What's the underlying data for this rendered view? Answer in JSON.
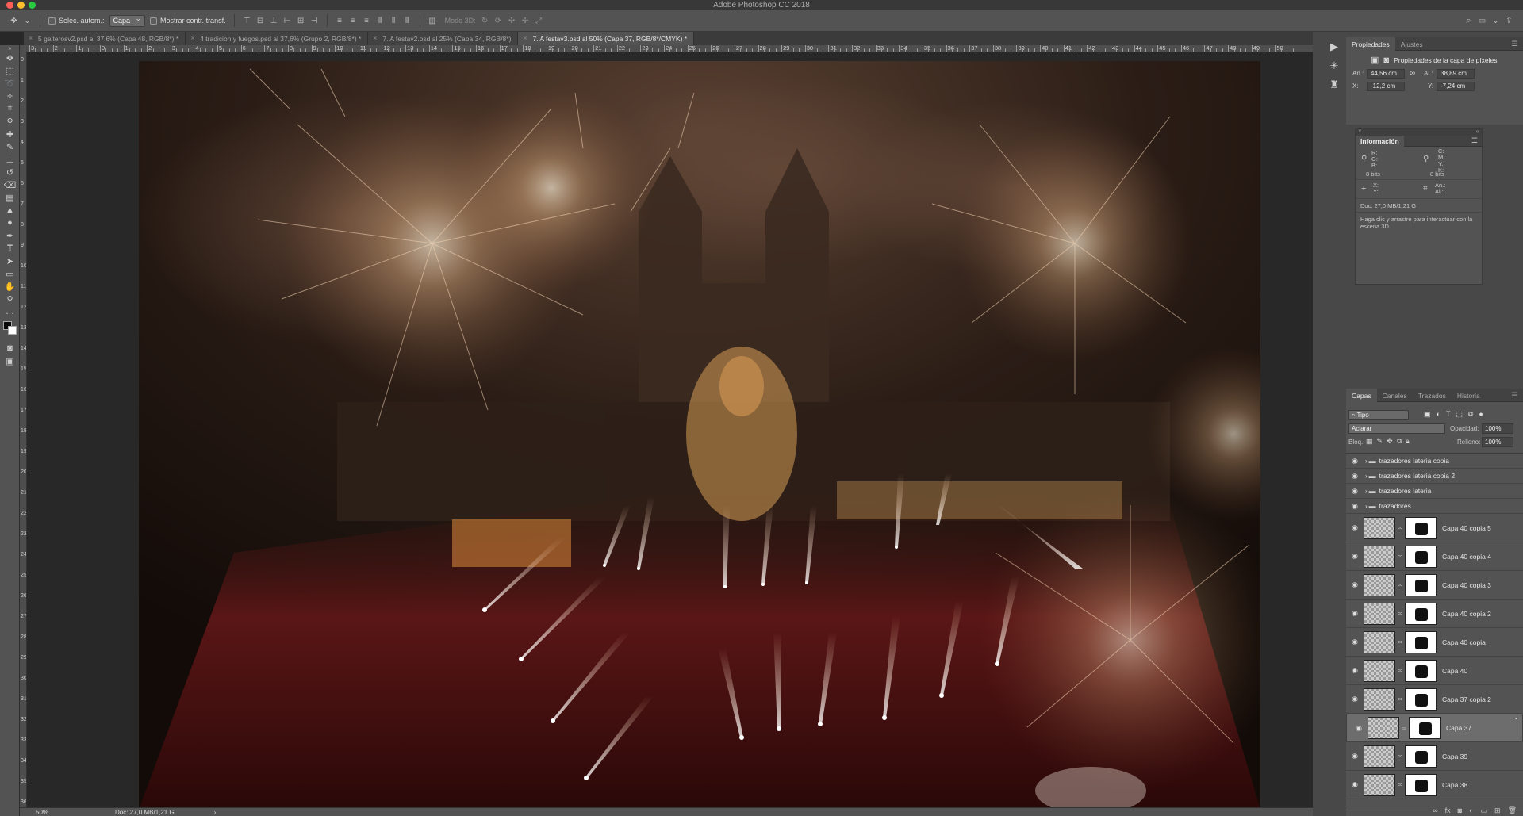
{
  "app": {
    "window_title": "Adobe Photoshop CC 2018"
  },
  "options_bar": {
    "auto_select_label": "Selec. autom.:",
    "auto_select_value": "Capa",
    "show_transform_label": "Mostrar contr. transf.",
    "mode3d_label": "Modo 3D:"
  },
  "tabs": [
    {
      "label": "5 gaiterosv2.psd al 37,6% (Capa 48, RGB/8*) *"
    },
    {
      "label": "4 tradicion y fuegos.psd al 37,6% (Grupo 2, RGB/8*) *"
    },
    {
      "label": "7. A festav2.psd al 25% (Capa 34, RGB/8*)"
    },
    {
      "label": "7. A festav3.psd al 50% (Capa 37, RGB/8*/CMYK) *"
    }
  ],
  "ruler_top": [
    "3",
    "2",
    "1",
    "0",
    "1",
    "2",
    "3",
    "4",
    "5",
    "6",
    "7",
    "8",
    "9",
    "10",
    "11",
    "12",
    "13",
    "14",
    "15",
    "16",
    "17",
    "18",
    "19",
    "20",
    "21",
    "22",
    "23",
    "24",
    "25",
    "26",
    "27",
    "28",
    "29",
    "30",
    "31",
    "32",
    "33",
    "34",
    "35",
    "36",
    "37",
    "38",
    "39",
    "40",
    "41",
    "42",
    "43",
    "44",
    "45",
    "46",
    "47",
    "48",
    "49",
    "50"
  ],
  "ruler_left": [
    "0",
    "1",
    "2",
    "3",
    "4",
    "5",
    "6",
    "7",
    "8",
    "9",
    "10",
    "11",
    "12",
    "13",
    "14",
    "15",
    "16",
    "17",
    "18",
    "19",
    "20",
    "21",
    "22",
    "23",
    "24",
    "25",
    "26",
    "27",
    "28",
    "29",
    "30",
    "31",
    "32",
    "33",
    "34",
    "35",
    "36"
  ],
  "status": {
    "zoom": "50%",
    "doc": "Doc: 27,0 MB/1,21 G"
  },
  "properties": {
    "tabs": [
      "Propiedades",
      "Ajustes"
    ],
    "title": "Propiedades de la capa de píxeles",
    "w_label": "An.:",
    "w_value": "44,56 cm",
    "h_label": "Al.:",
    "h_value": "38,89 cm",
    "x_label": "X:",
    "x_value": "-12,2 cm",
    "y_label": "Y:",
    "y_value": "-7,24 cm"
  },
  "info": {
    "title": "Información",
    "rgb": "R:\nG:\nB:",
    "cmyk": "C:\nM:\nY:\nK:",
    "bits1": "8 bits",
    "bits2": "8 bits",
    "xy": "X:\nY:",
    "wh": "An.:\nAl.:",
    "doc": "Doc: 27,0 MB/1,21 G",
    "hint": "Haga clic y arrastre para interactuar con la escena 3D."
  },
  "layers": {
    "tabs": [
      "Capas",
      "Canales",
      "Trazados",
      "Historia"
    ],
    "filter": "Tipo",
    "blend": "Aclarar",
    "opacity_label": "Opacidad:",
    "opacity_value": "100%",
    "lock_label": "Bloq.:",
    "fill_label": "Relleno:",
    "fill_value": "100%",
    "groups": [
      "trazadores lateria copia",
      "trazadores lateria copia 2",
      "trazadores lateria",
      "trazadores"
    ],
    "items": [
      "Capa 40 copia 5",
      "Capa 40 copia 4",
      "Capa 40 copia 3",
      "Capa 40 copia 2",
      "Capa 40 copia",
      "Capa 40",
      "Capa 37 copia 2",
      "Capa 37",
      "Capa 39",
      "Capa 38"
    ],
    "selected": "Capa 37"
  },
  "colors": {
    "accent": "#5a8de0",
    "panel": "#535353",
    "bg": "#282828"
  }
}
